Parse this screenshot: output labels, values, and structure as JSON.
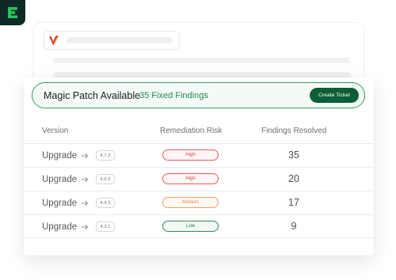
{
  "app": {
    "icon": "brand-e-logo"
  },
  "background_card": {
    "icon": "v-logo"
  },
  "banner": {
    "title": "Magic Patch Available",
    "subtitle": "35 Fixed Findings",
    "button_label": "Create Ticket"
  },
  "table": {
    "columns": [
      "Version",
      "Remediation Risk",
      "Findings Resolved"
    ],
    "rows": [
      {
        "action": "Upgrade",
        "version": "4.7.2",
        "risk": "High",
        "findings": "35"
      },
      {
        "action": "Upgrade",
        "version": "4.6.2",
        "risk": "High",
        "findings": "20"
      },
      {
        "action": "Upgrade",
        "version": "4.4.3",
        "risk": "Medium",
        "findings": "17"
      },
      {
        "action": "Upgrade",
        "version": "4.3.1",
        "risk": "Low",
        "findings": "9"
      }
    ]
  },
  "colors": {
    "brand_dark": "#0f2a24",
    "accent_green": "#2f9a62",
    "button_green": "#0b5e35",
    "risk_high": "#e45b5b",
    "risk_medium": "#f0a06a",
    "risk_low": "#2f8a5a"
  }
}
